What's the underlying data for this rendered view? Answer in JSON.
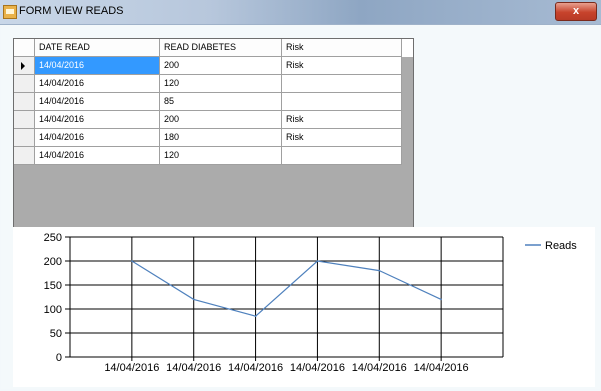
{
  "window": {
    "title": "FORM VIEW READS",
    "close_label": "x"
  },
  "grid": {
    "columns": [
      "DATE READ",
      "READ DIABETES",
      "Risk"
    ],
    "rows": [
      {
        "date": "14/04/2016",
        "value": "200",
        "risk": "Risk"
      },
      {
        "date": "14/04/2016",
        "value": "120",
        "risk": ""
      },
      {
        "date": "14/04/2016",
        "value": "85",
        "risk": ""
      },
      {
        "date": "14/04/2016",
        "value": "200",
        "risk": "Risk"
      },
      {
        "date": "14/04/2016",
        "value": "180",
        "risk": "Risk"
      },
      {
        "date": "14/04/2016",
        "value": "120",
        "risk": ""
      }
    ],
    "selected_row": 0
  },
  "chart_data": {
    "type": "line",
    "categories": [
      "14/04/2016",
      "14/04/2016",
      "14/04/2016",
      "14/04/2016",
      "14/04/2016",
      "14/04/2016"
    ],
    "series": [
      {
        "name": "Reads",
        "values": [
          200,
          120,
          85,
          200,
          180,
          120
        ],
        "color": "#4f81bd"
      }
    ],
    "ylim": [
      0,
      250
    ],
    "yticks": [
      0,
      50,
      100,
      150,
      200,
      250
    ],
    "grid": true,
    "legend": "top-right"
  }
}
